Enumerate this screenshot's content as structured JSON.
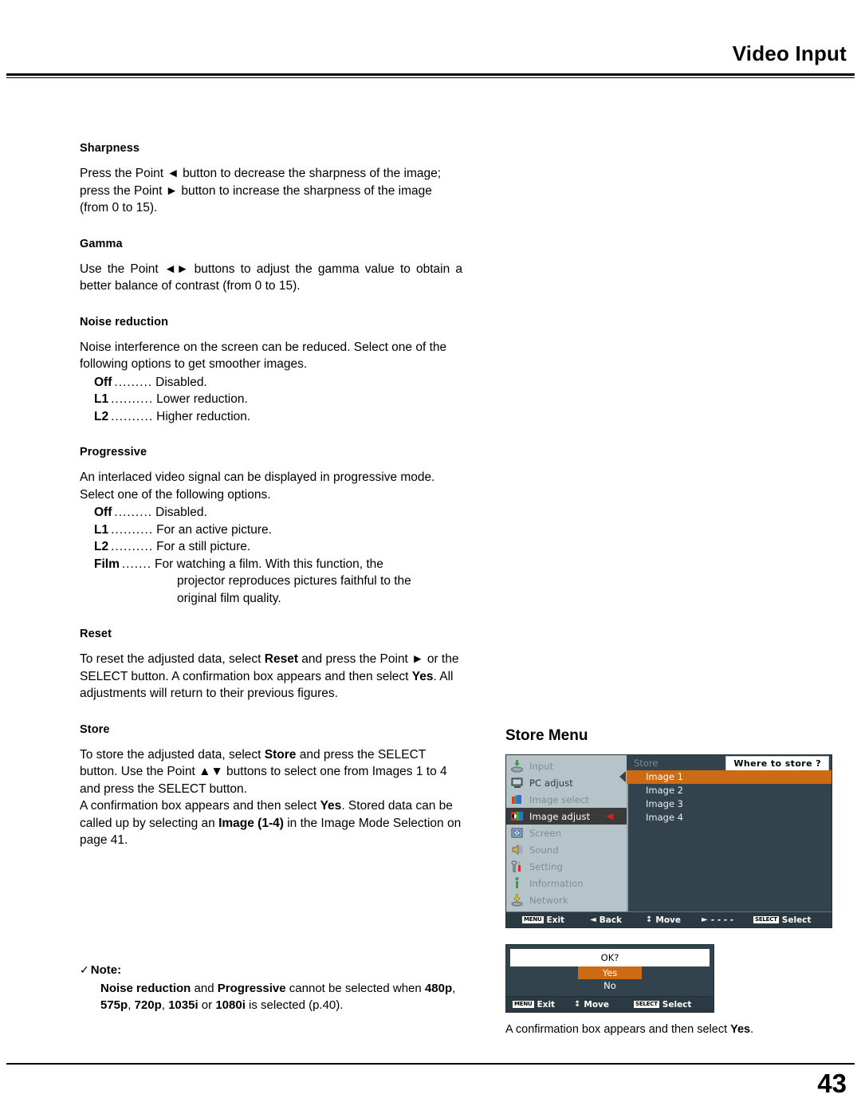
{
  "header": {
    "title": "Video Input"
  },
  "footer": {
    "page_number": "43"
  },
  "sections": [
    {
      "heading": "Sharpness",
      "body": "Press the Point ◄ button to decrease the sharpness of the image; press the Point ► button to increase the sharpness of the image (from 0 to 15)."
    },
    {
      "heading": "Gamma",
      "body": "Use the Point ◄► buttons to adjust the gamma value to obtain a better balance of contrast (from 0 to 15)."
    },
    {
      "heading": "Noise reduction",
      "body": "Noise interference on the screen can be reduced. Select one of the following options to get smoother images.",
      "definitions": [
        {
          "term": "Off",
          "dots": ".........",
          "desc": "Disabled."
        },
        {
          "term": "L1",
          "dots": "..........",
          "desc": "Lower reduction."
        },
        {
          "term": "L2",
          "dots": "..........",
          "desc": "Higher reduction."
        }
      ]
    },
    {
      "heading": "Progressive",
      "body": "An interlaced video signal can be displayed in progressive mode. Select one of the following options.",
      "definitions": [
        {
          "term": "Off",
          "dots": ".........",
          "desc": "Disabled."
        },
        {
          "term": "L1",
          "dots": "..........",
          "desc": "For an active picture."
        },
        {
          "term": "L2",
          "dots": "..........",
          "desc": "For a still picture."
        },
        {
          "term": "Film",
          "dots": ".......",
          "desc": "For watching a film. With this function, the",
          "continuation": [
            "projector reproduces pictures faithful to the",
            "original film quality."
          ]
        }
      ]
    },
    {
      "heading": "Reset",
      "body_parts": [
        {
          "t": "To reset the adjusted data, select "
        },
        {
          "t": "Reset",
          "b": true
        },
        {
          "t": " and press the Point ► or the SELECT button. A confirmation box appears and then select "
        },
        {
          "t": "Yes",
          "b": true
        },
        {
          "t": ". All adjustments will return to their previous figures."
        }
      ]
    },
    {
      "heading": "Store",
      "body_parts": [
        {
          "t": "To store the adjusted data, select "
        },
        {
          "t": "Store",
          "b": true
        },
        {
          "t": " and press the SELECT button. Use the Point ▲▼ buttons to select one from Images 1 to 4 and press the SELECT button."
        }
      ],
      "body_parts_2": [
        {
          "t": "A confirmation box appears and then select "
        },
        {
          "t": "Yes",
          "b": true
        },
        {
          "t": ". Stored data can be called up by selecting an "
        },
        {
          "t": "Image (1-4)",
          "b": true
        },
        {
          "t": " in the Image Mode Selection on page 41."
        }
      ]
    }
  ],
  "note": {
    "check": "✓",
    "label": "Note:",
    "parts": [
      {
        "t": "Noise reduction",
        "b": true
      },
      {
        "t": " and ",
        "b": false
      },
      {
        "t": "Progressive",
        "b": true
      },
      {
        "t": " cannot be selected when ",
        "b": false
      },
      {
        "t": "480p",
        "b": true
      },
      {
        "t": ", ",
        "b": false
      },
      {
        "t": "575p",
        "b": true
      },
      {
        "t": ", ",
        "b": false
      },
      {
        "t": "720p",
        "b": true
      },
      {
        "t": ", ",
        "b": false
      },
      {
        "t": "1035i",
        "b": true
      },
      {
        "t": " or ",
        "b": false
      },
      {
        "t": "1080i",
        "b": true
      },
      {
        "t": " is selected (p.40).",
        "b": false
      }
    ]
  },
  "figure": {
    "title": "Store Menu",
    "osd": {
      "sidebar": [
        {
          "label": "Input",
          "icon": "input-tray-icon",
          "state": "dim"
        },
        {
          "label": "PC adjust",
          "icon": "monitor-icon",
          "state": "bright"
        },
        {
          "label": "Image select",
          "icon": "rgb-layers-icon",
          "state": "dim"
        },
        {
          "label": "Image adjust",
          "icon": "image-adjust-icon",
          "state": "active",
          "chevron": "◄"
        },
        {
          "label": "Screen",
          "icon": "screen-arrows-icon",
          "state": "dim"
        },
        {
          "label": "Sound",
          "icon": "speaker-icon",
          "state": "dim"
        },
        {
          "label": "Setting",
          "icon": "tools-icon",
          "state": "dim"
        },
        {
          "label": "Information",
          "icon": "info-icon",
          "state": "dim"
        },
        {
          "label": "Network",
          "icon": "network-icon",
          "state": "dim"
        }
      ],
      "pane_title": "Store",
      "prompt": "Where to store ?",
      "options": [
        {
          "label": "Image 1",
          "selected": true
        },
        {
          "label": "Image 2",
          "selected": false
        },
        {
          "label": "Image 3",
          "selected": false
        },
        {
          "label": "Image 4",
          "selected": false
        }
      ],
      "bar": [
        {
          "key": "MENU",
          "label": "Exit",
          "glyph": ""
        },
        {
          "key": "",
          "label": "Back",
          "glyph": "◄"
        },
        {
          "key": "",
          "label": "Move",
          "glyph": "↕"
        },
        {
          "key": "",
          "label": "- - - -",
          "glyph": "►"
        },
        {
          "key": "SELECT",
          "label": "Select",
          "glyph": ""
        }
      ]
    },
    "confirm": {
      "question": "OK?",
      "yes": "Yes",
      "no": "No",
      "bar": [
        {
          "key": "MENU",
          "label": "Exit",
          "glyph": ""
        },
        {
          "key": "",
          "label": "Move",
          "glyph": "↕"
        },
        {
          "key": "SELECT",
          "label": "Select",
          "glyph": ""
        }
      ]
    },
    "caption_parts": [
      {
        "t": "A confirmation box appears and then select "
      },
      {
        "t": "Yes",
        "b": true
      },
      {
        "t": "."
      }
    ]
  },
  "colors": {
    "osd_panel": "#32434d",
    "osd_sidebar": "#b6c4ca",
    "highlight_orange": "#cc6a16",
    "active_row": "#3a3a3a",
    "chevron_red": "#e02020",
    "bar": "#2a3942"
  }
}
